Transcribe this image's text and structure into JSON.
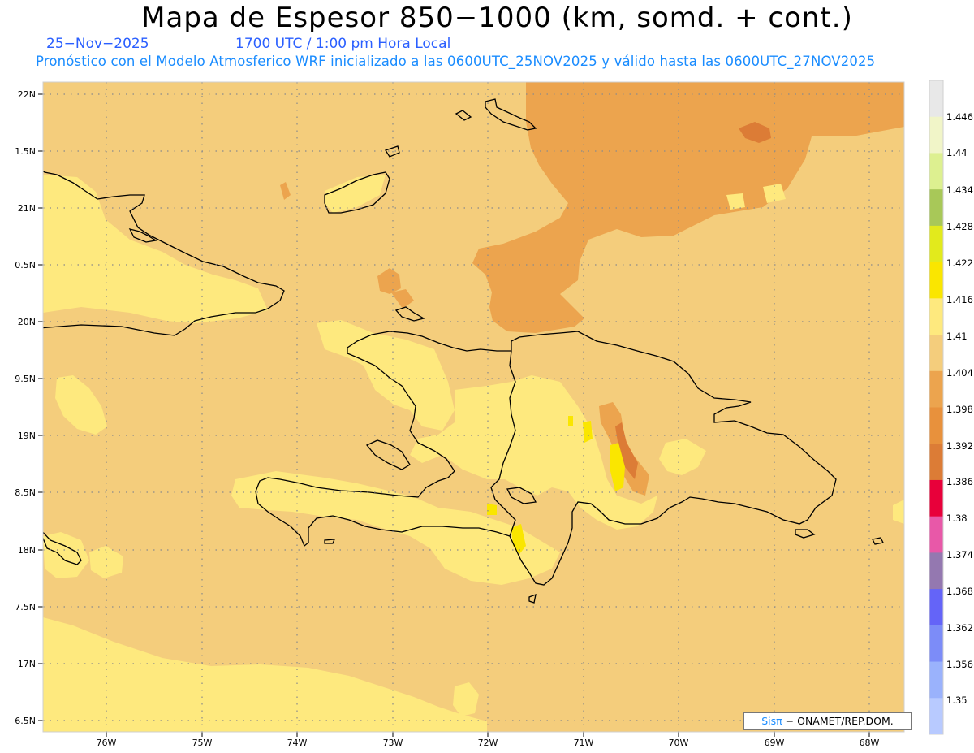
{
  "header": {
    "title": "Mapa de Espesor 850−1000 (km, somd. + cont.)",
    "date": "25−Nov−2025",
    "time": "1700 UTC / 1:00 pm Hora Local",
    "subtitle": "Pronóstico con el Modelo Atmosferico WRF inicializado a las 0600UTC_25NOV2025 y válido hasta las  0600UTC_27NOV2025"
  },
  "map": {
    "lat_labels": [
      "22N",
      "1.5N",
      "21N",
      "0.5N",
      "20N",
      "9.5N",
      "19N",
      "8.5N",
      "18N",
      "7.5N",
      "17N",
      "6.5N"
    ],
    "lon_labels": [
      "76W",
      "75W",
      "74W",
      "73W",
      "72W",
      "71W",
      "70W",
      "69W",
      "68W"
    ]
  },
  "colorbar": {
    "labels": [
      "1.446",
      "1.44",
      "1.434",
      "1.428",
      "1.422",
      "1.416",
      "1.41",
      "1.404",
      "1.398",
      "1.392",
      "1.386",
      "1.38",
      "1.374",
      "1.368",
      "1.362",
      "1.356",
      "1.35"
    ],
    "colors": [
      "#e8e8e8",
      "#f1f5c8",
      "#ddf090",
      "#a8c858",
      "#e2ea1c",
      "#fae600",
      "#fee97e",
      "#f4cd7c",
      "#eca44e",
      "#e8913c",
      "#dc7c36",
      "#e8003a",
      "#e858a8",
      "#9478b0",
      "#6464f8",
      "#7c8cf8",
      "#9ab2fc",
      "#b8caff"
    ]
  },
  "credit": {
    "brand": "Sisπ",
    "text": "− ONAMET/REP.DOM."
  }
}
